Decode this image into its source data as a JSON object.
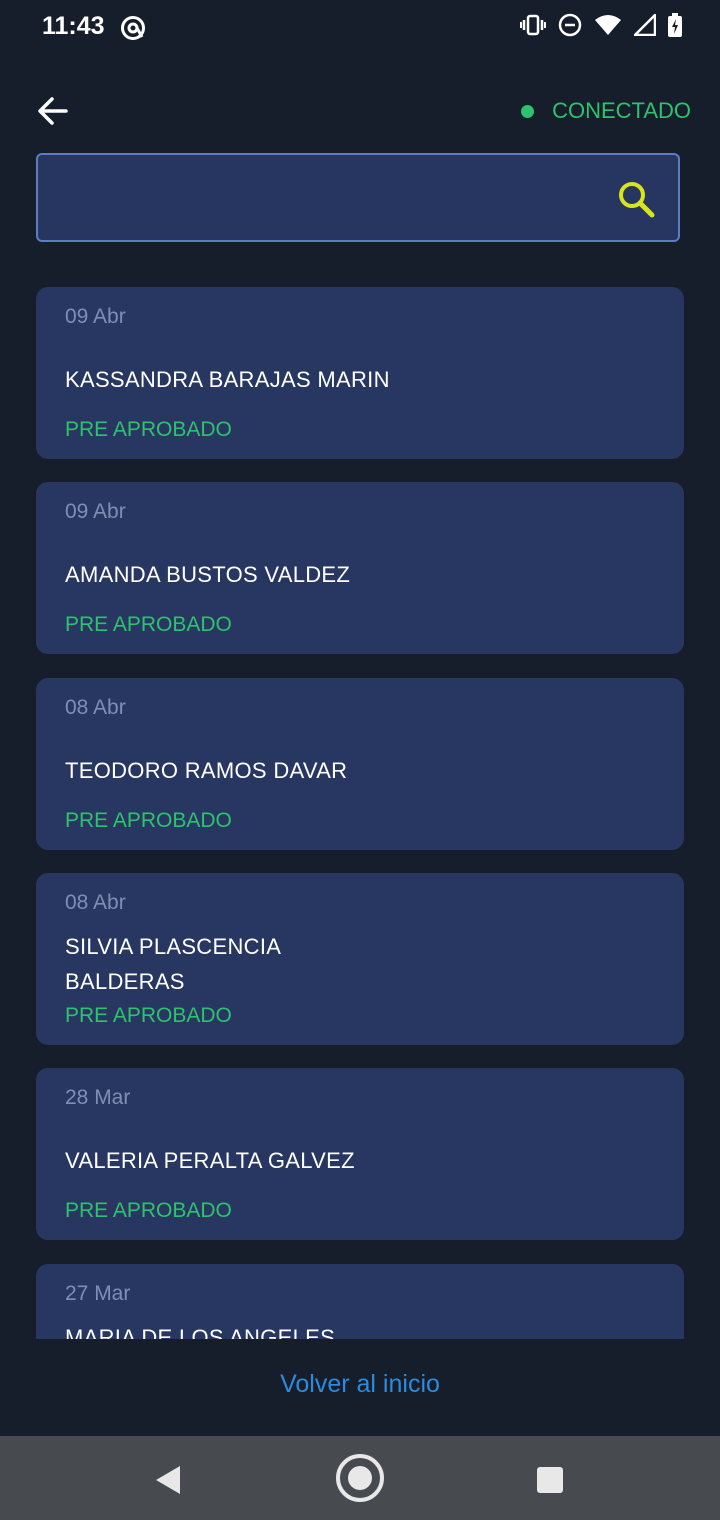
{
  "status_bar": {
    "time": "11:43"
  },
  "header": {
    "connection_label": "CONECTADO",
    "connection_color": "#2ec26e"
  },
  "search": {
    "value": "",
    "placeholder": ""
  },
  "records": [
    {
      "date": "09 Abr",
      "name": "KASSANDRA  BARAJAS MARIN",
      "status": "PRE APROBADO"
    },
    {
      "date": "09 Abr",
      "name": "AMANDA  BUSTOS VALDEZ",
      "status": "PRE APROBADO"
    },
    {
      "date": "08 Abr",
      "name": "TEODORO  RAMOS DAVAR",
      "status": "PRE APROBADO"
    },
    {
      "date": "08 Abr",
      "name": "SILVIA  PLASCENCIA BALDERAS",
      "status": "PRE APROBADO"
    },
    {
      "date": "28 Mar",
      "name": "VALERIA  PERALTA GALVEZ",
      "status": "PRE APROBADO"
    },
    {
      "date": "27 Mar",
      "name": "MARIA DE LOS ANGELES",
      "status": ""
    }
  ],
  "footer": {
    "back_home_label": "Volver al inicio"
  },
  "colors": {
    "background": "#161d2b",
    "card": "#273761",
    "accent_green": "#2ec26e",
    "accent_yellow": "#d7e61a",
    "link_blue": "#2c8bdc"
  }
}
